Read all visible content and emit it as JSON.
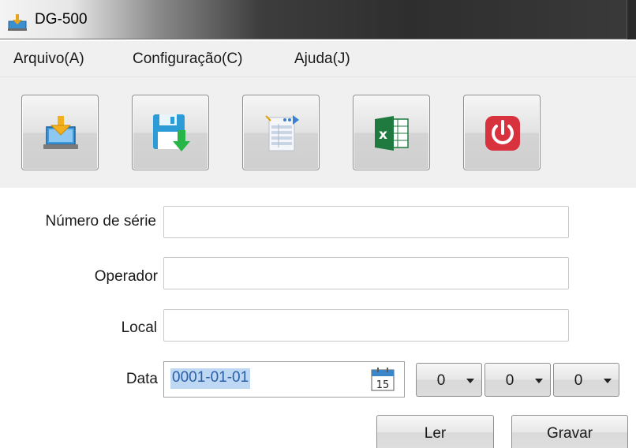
{
  "window": {
    "title": "DG-500"
  },
  "menu": [
    {
      "label": "Arquivo(A)"
    },
    {
      "label": "Configuração(C)"
    },
    {
      "label": "Ajuda(J)"
    }
  ],
  "toolbar": {
    "buttons": [
      {
        "icon": "download-device-icon"
      },
      {
        "icon": "save-icon"
      },
      {
        "icon": "report-icon"
      },
      {
        "icon": "excel-icon"
      },
      {
        "icon": "power-icon"
      }
    ]
  },
  "form": {
    "serial_label": "Número de série",
    "serial_value": "",
    "operator_label": "Operador",
    "operator_value": "",
    "location_label": "Local",
    "location_value": "",
    "date_label": "Data",
    "date_value": "0001-01-01",
    "calendar_day": "15",
    "time_selectors": [
      "0",
      "0",
      "0"
    ]
  },
  "actions": {
    "read_label": "Ler",
    "save_label": "Gravar"
  },
  "colors": {
    "power_red": "#d9323f",
    "excel_green": "#1f7a3f",
    "save_blue": "#2d9bd6",
    "date_selection": "#bed7f2"
  }
}
